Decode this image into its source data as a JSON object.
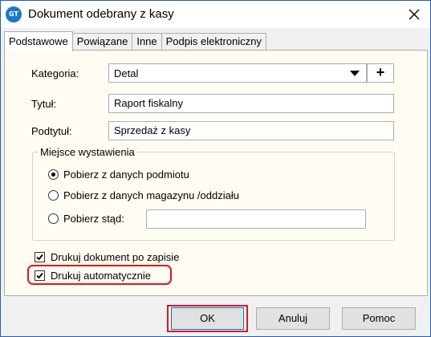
{
  "window": {
    "title": "Dokument odebrany z kasy",
    "app_icon_text": "GT"
  },
  "tabs": [
    {
      "label": "Podstawowe",
      "active": true
    },
    {
      "label": "Powiązane",
      "active": false
    },
    {
      "label": "Inne",
      "active": false
    },
    {
      "label": "Podpis elektroniczny",
      "active": false
    }
  ],
  "form": {
    "kategoria_label": "Kategoria:",
    "kategoria_value": "Detal",
    "kategoria_add": "+",
    "tytul_label": "Tytuł:",
    "tytul_value": "Raport fiskalny",
    "podtytul_label": "Podtytuł:",
    "podtytul_value": "Sprzedaż z kasy"
  },
  "miejsce": {
    "legend": "Miejsce wystawienia",
    "options": [
      {
        "label": "Pobierz z danych podmiotu",
        "selected": true
      },
      {
        "label": "Pobierz z danych magazynu /oddziału",
        "selected": false
      },
      {
        "label": "Pobierz stąd:",
        "selected": false
      }
    ],
    "stad_value": ""
  },
  "checks": [
    {
      "label": "Drukuj dokument po zapisie",
      "checked": true
    },
    {
      "label": "Drukuj automatycznie",
      "checked": true
    }
  ],
  "buttons": {
    "ok": "OK",
    "cancel": "Anuluj",
    "help": "Pomoc"
  },
  "colors": {
    "highlight": "#e0161b",
    "panel_bg": "#fffdf3",
    "title_border": "#1f5fbf"
  }
}
